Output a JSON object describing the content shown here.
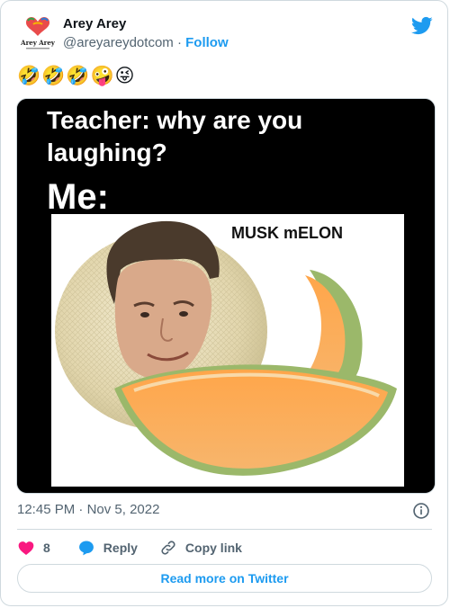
{
  "author": {
    "name": "Arey Arey",
    "handle": "@areyareydotcom",
    "separator": "·",
    "follow_label": "Follow",
    "avatar_text": "Arey Arey"
  },
  "tweet": {
    "text": "🤣🤣🤣🤪😜"
  },
  "media": {
    "headline_line1": "Teacher: why are you",
    "headline_line2": "laughing?",
    "headline_line3": "Me:",
    "caption": "MUSK mELON"
  },
  "meta": {
    "time": "12:45 PM",
    "separator": "·",
    "date": "Nov 5, 2022"
  },
  "actions": {
    "like_count": "8",
    "reply_label": "Reply",
    "copy_label": "Copy link"
  },
  "cta": {
    "label": "Read more on Twitter"
  },
  "colors": {
    "accent": "#1d9bf0",
    "like": "#f91880",
    "secondary_text": "#536471",
    "border": "#cfd9de"
  },
  "icons": [
    "twitter-bird-icon",
    "info-icon",
    "heart-icon",
    "reply-icon",
    "link-icon"
  ]
}
